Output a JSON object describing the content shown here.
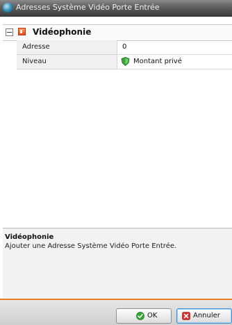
{
  "window": {
    "title": "Adresses Système Vidéo Porte Entrée",
    "accent_color": "#f07a1e"
  },
  "section": {
    "title": "Vidéophonie",
    "icon": "videophone-icon",
    "collapse_icon": "collapse-icon"
  },
  "properties": [
    {
      "name": "Adresse",
      "value": "0"
    },
    {
      "name": "Niveau",
      "value": "Montant privé",
      "icon": "green-shield-icon"
    }
  ],
  "description": {
    "title": "Vidéophonie",
    "text": "Ajouter une Adresse Système Vidéo Porte Entrée."
  },
  "buttons": {
    "ok_label": "OK",
    "ok_icon": "green-check-icon",
    "cancel_label": "Annuler",
    "cancel_icon": "red-x-icon"
  }
}
